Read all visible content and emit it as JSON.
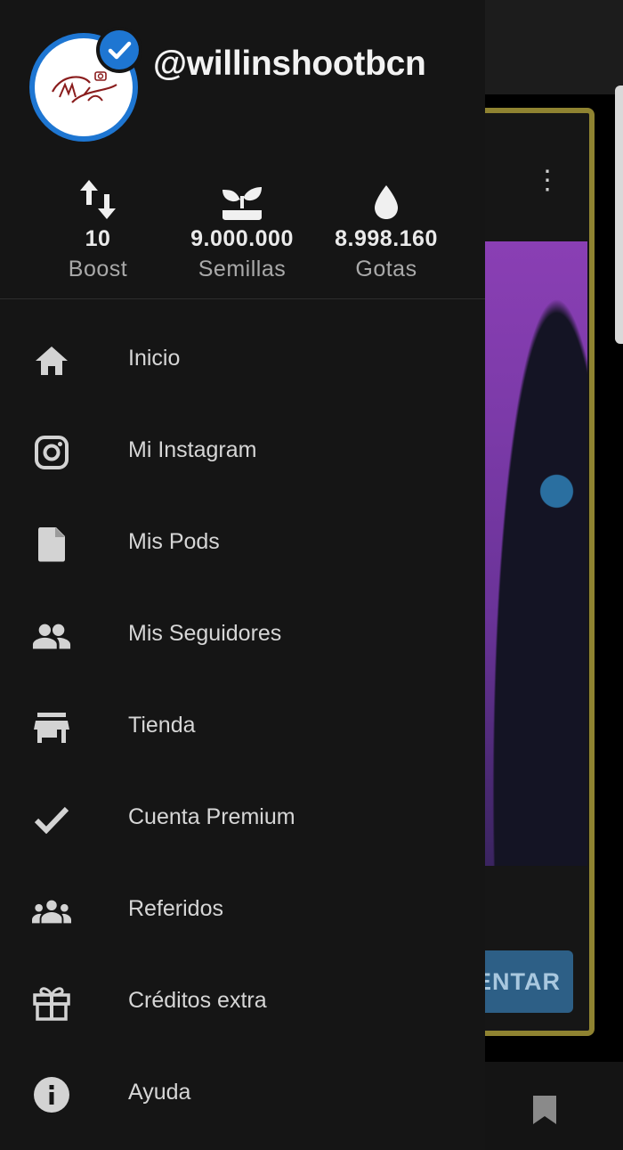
{
  "profile": {
    "username": "@willinshootbcn",
    "avatar_text": "Willin Shoot"
  },
  "stats": [
    {
      "icon": "swap-vertical-icon",
      "value": "10",
      "label": "Boost"
    },
    {
      "icon": "seedling-icon",
      "value": "9.000.000",
      "label": "Semillas"
    },
    {
      "icon": "water-drop-icon",
      "value": "8.998.160",
      "label": "Gotas"
    }
  ],
  "menu": [
    {
      "icon": "home-icon",
      "label": "Inicio"
    },
    {
      "icon": "instagram-icon",
      "label": "Mi Instagram"
    },
    {
      "icon": "file-icon",
      "label": "Mis Pods"
    },
    {
      "icon": "people-icon",
      "label": "Mis Seguidores"
    },
    {
      "icon": "store-icon",
      "label": "Tienda"
    },
    {
      "icon": "check-icon",
      "label": "Cuenta Premium"
    },
    {
      "icon": "groups-icon",
      "label": "Referidos"
    },
    {
      "icon": "gift-icon",
      "label": "Créditos extra"
    },
    {
      "icon": "info-icon",
      "label": "Ayuda"
    }
  ],
  "background": {
    "button_text": "ENTAR"
  },
  "colors": {
    "accent": "#1e76d2",
    "drawer_bg": "#151515",
    "card_border": "#8f8331",
    "icon": "#d3d3d3"
  }
}
